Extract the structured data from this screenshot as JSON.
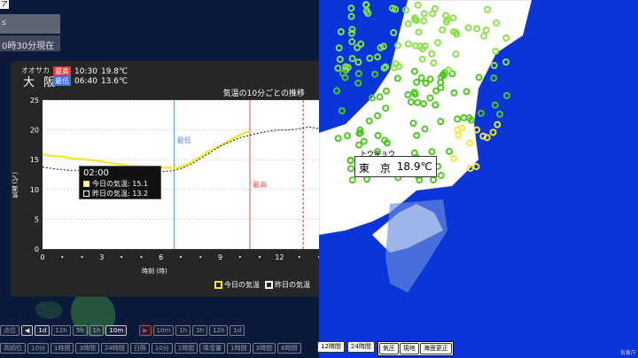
{
  "left": {
    "corner_glyph": "ア",
    "top_label": "s",
    "time_label": "0時30分現在"
  },
  "station": {
    "kana": "オオサカ",
    "name": "大 阪",
    "max_tag": "最高",
    "max_time": "10:30",
    "max_temp": "19.8℃",
    "min_tag": "最低",
    "min_time": "06:40",
    "min_temp": "13.6℃"
  },
  "chart_data": {
    "type": "line",
    "title": "気温の10分ごとの推移",
    "xlabel": "時刻 (時)",
    "ylabel": "気温 (℃)",
    "xlim": [
      0,
      14
    ],
    "ylim": [
      0,
      25
    ],
    "x_ticks": [
      "0",
      "3",
      "6",
      "9",
      "12"
    ],
    "y_ticks": [
      "0",
      "5",
      "10",
      "15",
      "20",
      "25"
    ],
    "markers": [
      {
        "x": 6.67,
        "label": "最低",
        "color": "#5b8fd6"
      },
      {
        "x": 10.5,
        "label": "最高",
        "color": "#e05050"
      }
    ],
    "current_x": 13.2,
    "series": [
      {
        "name": "今日の気温",
        "color": "#f5e83a",
        "x": [
          0,
          0.5,
          1,
          1.5,
          2,
          2.5,
          3,
          3.5,
          4,
          4.5,
          5,
          5.5,
          6,
          6.67,
          7,
          7.5,
          8,
          8.5,
          9,
          9.5,
          10,
          10.5
        ],
        "y": [
          15.9,
          15.6,
          15.5,
          15.2,
          15.1,
          14.9,
          14.7,
          14.4,
          14.2,
          14.0,
          13.9,
          13.8,
          13.7,
          13.6,
          13.8,
          14.5,
          15.5,
          16.6,
          17.3,
          18.3,
          19.2,
          19.8
        ]
      },
      {
        "name": "昨日の気温",
        "color": "#ffffff",
        "x": [
          0,
          0.5,
          1,
          1.5,
          2,
          2.5,
          3,
          3.5,
          4,
          4.5,
          5,
          5.5,
          6,
          6.5,
          7,
          7.5,
          8,
          8.5,
          9,
          9.5,
          10,
          10.5,
          11,
          11.5,
          12,
          12.5,
          13,
          13.5,
          14
        ],
        "y": [
          13.8,
          13.5,
          13.3,
          13.2,
          13.2,
          13.3,
          13.4,
          13.4,
          13.4,
          13.3,
          13.2,
          13.0,
          13.0,
          13.1,
          13.5,
          14.2,
          15.2,
          16.2,
          17.3,
          18.0,
          18.7,
          19.1,
          19.5,
          19.8,
          20.0,
          20.0,
          20.2,
          20.5,
          20.2
        ]
      }
    ]
  },
  "tooltip": {
    "time": "02:00",
    "today": "今日の気温: 15.1",
    "yesterday": "昨日の気温: 13.2"
  },
  "legend": {
    "today": "今日の気温",
    "yesterday": "昨日の気温"
  },
  "tokyo": {
    "kana": "トウキョウ",
    "name": "東 京",
    "temp": "18.9℃"
  },
  "zoom": {
    "in": "+",
    "out": "−"
  },
  "attribution": "気象庁",
  "left_bar1": [
    "点位",
    "1d",
    "12h",
    "3h",
    "1h",
    "10m"
  ],
  "left_bar1_right": [
    "10m",
    "1h",
    "3h",
    "12h",
    "1d"
  ],
  "left_bar2": [
    "高順位",
    "10分",
    "1時間",
    "3時間",
    "24時間",
    "日照",
    "10分",
    "1時間",
    "降雪量",
    "1時間",
    "3時間",
    "6時間",
    "12時間"
  ],
  "right_bar": {
    "hours_a": "12時間",
    "hours_b": "24時間",
    "group1": [
      "気圧",
      "現地",
      "海面更正"
    ]
  }
}
